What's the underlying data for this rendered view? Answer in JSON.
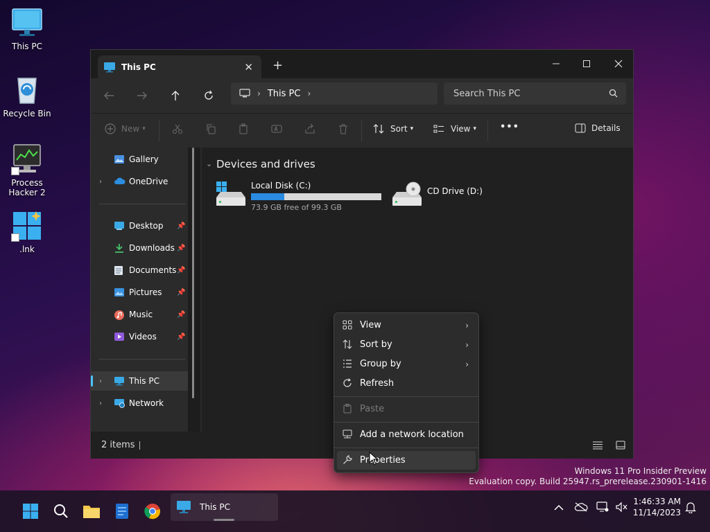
{
  "desktop": {
    "icons": [
      {
        "label": "This PC"
      },
      {
        "label": "Recycle Bin"
      },
      {
        "label": "Process Hacker 2"
      },
      {
        "label": ".lnk"
      }
    ]
  },
  "window": {
    "tab_title": "This PC",
    "tab_close": "✕",
    "new_tab": "+",
    "address": {
      "segments": [
        "This PC"
      ]
    },
    "search_placeholder": "Search This PC",
    "toolbar": {
      "new_label": "New",
      "sort_label": "Sort",
      "view_label": "View",
      "more_label": "•••",
      "details_label": "Details"
    },
    "sidebar": {
      "items": [
        {
          "label": "Gallery"
        },
        {
          "label": "OneDrive"
        },
        {
          "label": "Desktop"
        },
        {
          "label": "Downloads"
        },
        {
          "label": "Documents"
        },
        {
          "label": "Pictures"
        },
        {
          "label": "Music"
        },
        {
          "label": "Videos"
        },
        {
          "label": "This PC"
        },
        {
          "label": "Network"
        }
      ]
    },
    "content": {
      "section_title": "Devices and drives",
      "drives": [
        {
          "name": "Local Disk (C:)",
          "free_text": "73.9 GB free of 99.3 GB",
          "used_fraction": 0.256
        },
        {
          "name": "CD Drive (D:)"
        }
      ]
    },
    "status": {
      "items_text": "2 items"
    }
  },
  "context_menu": {
    "items": [
      {
        "label": "View"
      },
      {
        "label": "Sort by"
      },
      {
        "label": "Group by"
      },
      {
        "label": "Refresh"
      },
      {
        "label": "Paste"
      },
      {
        "label": "Add a network location"
      },
      {
        "label": "Properties"
      }
    ]
  },
  "watermark": {
    "line1": "Windows 11 Pro Insider Preview",
    "line2": "Evaluation copy. Build 25947.rs_prerelease.230901-1416"
  },
  "taskbar": {
    "active_app": "This PC",
    "time": "1:46:33 AM",
    "date": "11/14/2023"
  }
}
